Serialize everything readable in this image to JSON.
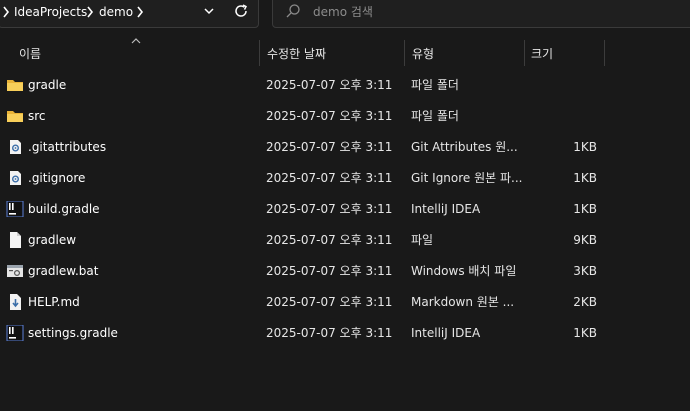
{
  "address": {
    "breadcrumbs": [
      "IdeaProjects",
      "demo"
    ]
  },
  "search": {
    "placeholder": "demo 검색"
  },
  "columns": {
    "name": "이름",
    "date": "수정한 날짜",
    "type": "유형",
    "size": "크기"
  },
  "files": [
    {
      "name": "gradle",
      "date": "2025-07-07 오후 3:11",
      "type": "파일 폴더",
      "size": "",
      "icon": "folder-icon"
    },
    {
      "name": "src",
      "date": "2025-07-07 오후 3:11",
      "type": "파일 폴더",
      "size": "",
      "icon": "folder-icon"
    },
    {
      "name": ".gitattributes",
      "date": "2025-07-07 오후 3:11",
      "type": "Git Attributes 원...",
      "size": "1KB",
      "icon": "config-file-icon"
    },
    {
      "name": ".gitignore",
      "date": "2025-07-07 오후 3:11",
      "type": "Git Ignore 원본 파...",
      "size": "1KB",
      "icon": "config-file-icon"
    },
    {
      "name": "build.gradle",
      "date": "2025-07-07 오후 3:11",
      "type": "IntelliJ IDEA",
      "size": "1KB",
      "icon": "intellij-file-icon"
    },
    {
      "name": "gradlew",
      "date": "2025-07-07 오후 3:11",
      "type": "파일",
      "size": "9KB",
      "icon": "blank-file-icon"
    },
    {
      "name": "gradlew.bat",
      "date": "2025-07-07 오후 3:11",
      "type": "Windows 배치 파일",
      "size": "3KB",
      "icon": "batch-file-icon"
    },
    {
      "name": "HELP.md",
      "date": "2025-07-07 오후 3:11",
      "type": "Markdown 원본 ...",
      "size": "2KB",
      "icon": "markdown-file-icon"
    },
    {
      "name": "settings.gradle",
      "date": "2025-07-07 오후 3:11",
      "type": "IntelliJ IDEA",
      "size": "1KB",
      "icon": "intellij-file-icon"
    }
  ]
}
